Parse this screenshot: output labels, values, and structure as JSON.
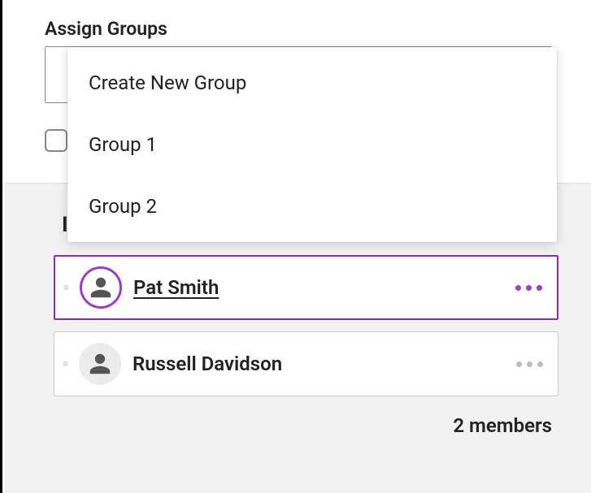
{
  "assign_label": "Assign Groups",
  "dropdown": {
    "items": [
      {
        "label": "Create New Group"
      },
      {
        "label": "Group 1"
      },
      {
        "label": "Group 2"
      }
    ]
  },
  "lead_letter": "I",
  "members": [
    {
      "name": "Pat Smith"
    },
    {
      "name": "Russell Davidson"
    }
  ],
  "member_count_text": "2 members"
}
